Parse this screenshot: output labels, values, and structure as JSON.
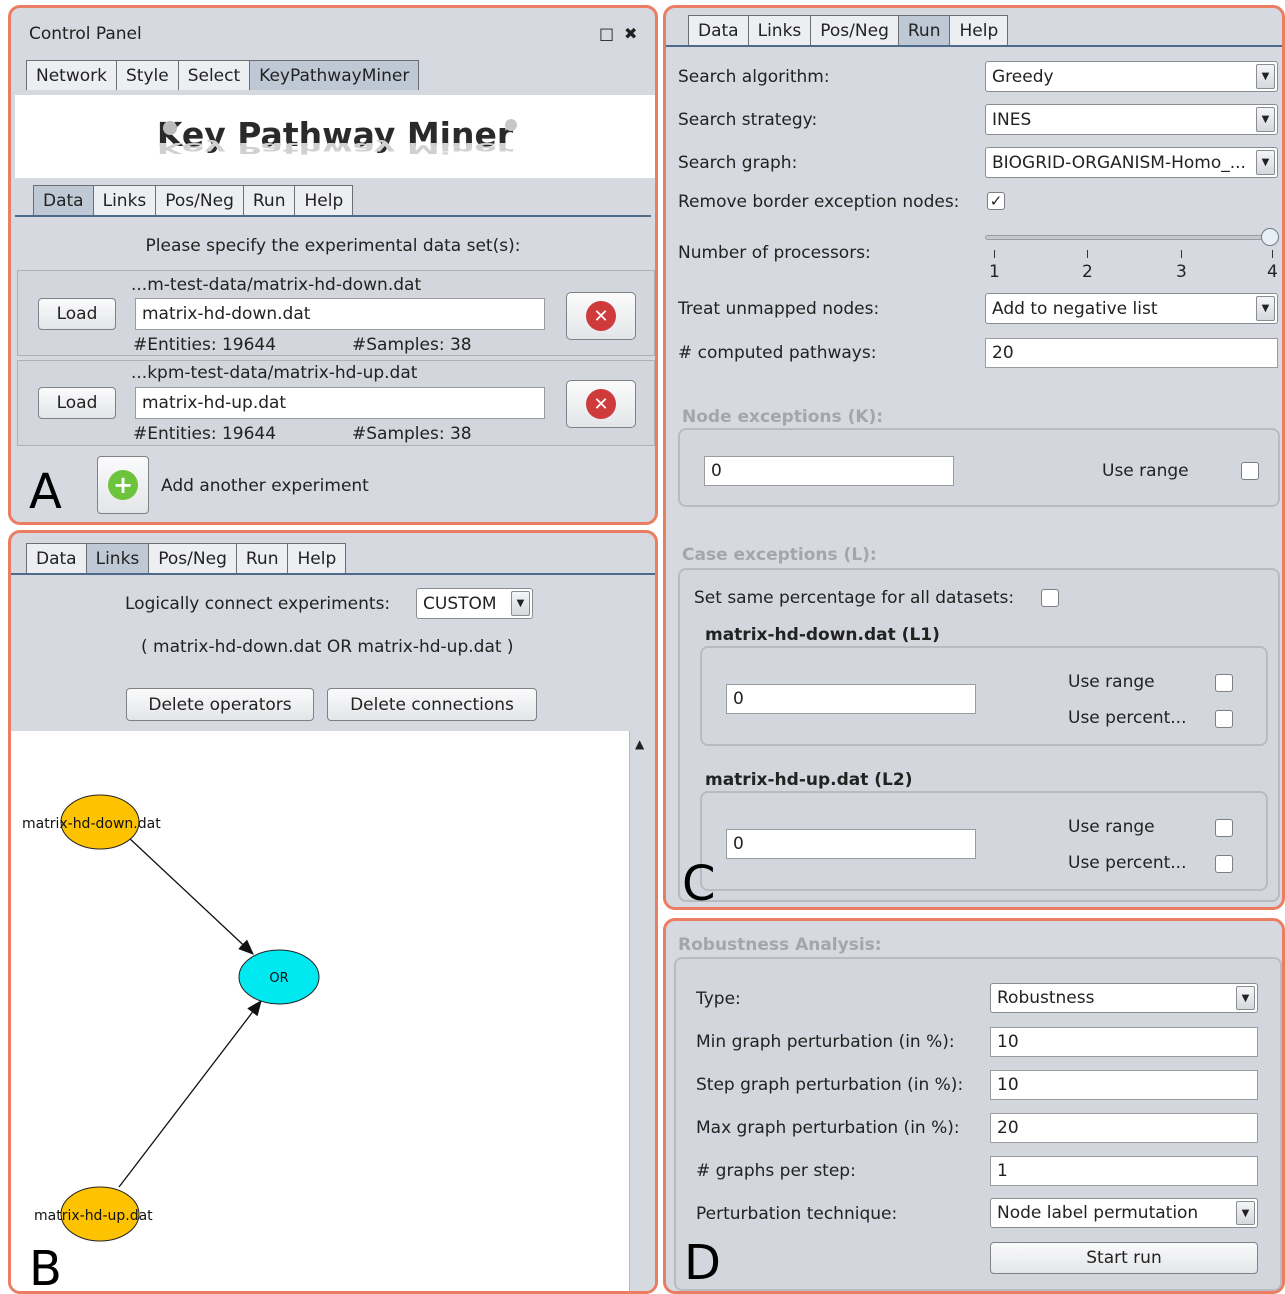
{
  "panelA": {
    "title": "Control Panel",
    "window_icons": {
      "restore": "□",
      "close": "✖"
    },
    "main_tabs": [
      {
        "label": "Network"
      },
      {
        "label": "Style"
      },
      {
        "label": "Select"
      },
      {
        "label": "KeyPathwayMiner",
        "active": true
      }
    ],
    "banner": {
      "title": "Key Pathway Miner",
      "reflection": "Key Pathway Miner"
    },
    "sub_tabs": [
      {
        "label": "Data",
        "active": true
      },
      {
        "label": "Links"
      },
      {
        "label": "Pos/Neg"
      },
      {
        "label": "Run"
      },
      {
        "label": "Help"
      }
    ],
    "instruction": "Please specify the experimental data set(s):",
    "experiments": [
      {
        "path": "...m-test-data/matrix-hd-down.dat",
        "load_label": "Load",
        "file": "matrix-hd-down.dat",
        "entities": "#Entities: 19644",
        "samples": "#Samples: 38"
      },
      {
        "path": "...kpm-test-data/matrix-hd-up.dat",
        "load_label": "Load",
        "file": "matrix-hd-up.dat",
        "entities": "#Entities: 19644",
        "samples": "#Samples: 38"
      }
    ],
    "add_label": "Add another experiment",
    "letter": "A"
  },
  "panelB": {
    "tabs": [
      {
        "label": "Data"
      },
      {
        "label": "Links",
        "active": true
      },
      {
        "label": "Pos/Neg"
      },
      {
        "label": "Run"
      },
      {
        "label": "Help"
      }
    ],
    "connect_label": "Logically connect experiments:",
    "connect_value": "CUSTOM",
    "formula": "( matrix-hd-down.dat OR matrix-hd-up.dat )",
    "delete_operators": "Delete operators",
    "delete_connections": "Delete connections",
    "graph": {
      "node_down": "matrix-hd-down.dat",
      "node_up": "matrix-hd-up.dat",
      "operator": "OR",
      "data_color": "#fdc300",
      "operator_color": "#00e8f0"
    },
    "letter": "B"
  },
  "panelC": {
    "tabs": [
      {
        "label": "Data"
      },
      {
        "label": "Links"
      },
      {
        "label": "Pos/Neg"
      },
      {
        "label": "Run",
        "active": true
      },
      {
        "label": "Help"
      }
    ],
    "search_algorithm_label": "Search algorithm:",
    "search_algorithm": "Greedy",
    "search_strategy_label": "Search strategy:",
    "search_strategy": "INES",
    "search_graph_label": "Search graph:",
    "search_graph": "BIOGRID-ORGANISM-Homo_...",
    "remove_border_label": "Remove border exception nodes:",
    "remove_border_checked": true,
    "processors_label": "Number of processors:",
    "processor_ticks": [
      "1",
      "2",
      "3",
      "4"
    ],
    "processors_value": 4,
    "unmapped_label": "Treat unmapped nodes:",
    "unmapped_value": "Add to negative list",
    "computed_label": "# computed pathways:",
    "computed_value": "20",
    "node_exceptions_title": "Node exceptions (K):",
    "node_exceptions_value": "0",
    "use_range": "Use range",
    "case_exceptions_title": "Case exceptions (L):",
    "same_percentage_label": "Set same percentage for all datasets:",
    "datasets": [
      {
        "title": "matrix-hd-down.dat (L1)",
        "value": "0",
        "use_range": "Use range",
        "use_percent": "Use percent..."
      },
      {
        "title": "matrix-hd-up.dat (L2)",
        "value": "0",
        "use_range": "Use range",
        "use_percent": "Use percent..."
      }
    ],
    "letter": "C"
  },
  "panelD": {
    "title": "Robustness Analysis:",
    "type_label": "Type:",
    "type_value": "Robustness",
    "min_label": "Min graph perturbation (in %):",
    "min_value": "10",
    "step_label": "Step graph perturbation (in %):",
    "step_value": "10",
    "max_label": "Max graph perturbation (in %):",
    "max_value": "20",
    "graphs_label": "# graphs per step:",
    "graphs_value": "1",
    "technique_label": "Perturbation technique:",
    "technique_value": "Node label permutation",
    "start_label": "Start run",
    "letter": "D"
  }
}
